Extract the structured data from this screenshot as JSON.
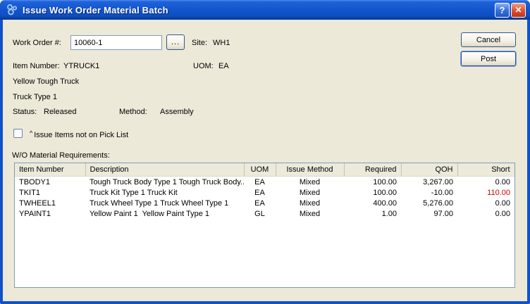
{
  "window": {
    "title": "Issue Work Order Material Batch",
    "help_label": "?",
    "close_label": "✕"
  },
  "form": {
    "work_order_label": "Work Order #:",
    "work_order_value": "10060-1",
    "lookup_label": "...",
    "site_label": "Site:",
    "site_value": "WH1",
    "item_number_label": "Item Number:",
    "item_number_value": "YTRUCK1",
    "uom_label": "UOM:",
    "uom_value": "EA",
    "item_desc_line1": "Yellow Tough Truck",
    "item_desc_line2": "Truck Type 1",
    "status_label": "Status:",
    "status_value": "Released",
    "method_label": "Method:",
    "method_value": "Assembly",
    "checkbox_caret": "^",
    "checkbox_label": "Issue Items not on Pick List",
    "checkbox_checked": false,
    "grid_caption": "W/O Material Requirements:"
  },
  "buttons": {
    "cancel": "Cancel",
    "post": "Post"
  },
  "grid": {
    "columns": [
      "Item Number",
      "Description",
      "UOM",
      "Issue Method",
      "Required",
      "QOH",
      "Short"
    ],
    "rows": [
      {
        "item": "TBODY1",
        "desc": "Tough Truck Body Type 1 Tough Truck Body...",
        "uom": "EA",
        "method": "Mixed",
        "required": "100.00",
        "qoh": "3,267.00",
        "short": "0.00",
        "short_alert": false
      },
      {
        "item": "TKIT1",
        "desc": "Truck Kit Type 1 Truck Kit",
        "uom": "EA",
        "method": "Mixed",
        "required": "100.00",
        "qoh": "-10.00",
        "short": "110.00",
        "short_alert": true
      },
      {
        "item": "TWHEEL1",
        "desc": "Truck Wheel Type 1 Truck Wheel Type 1",
        "uom": "EA",
        "method": "Mixed",
        "required": "400.00",
        "qoh": "5,276.00",
        "short": "0.00",
        "short_alert": false
      },
      {
        "item": "YPAINT1",
        "desc": "Yellow Paint 1  Yellow Paint Type 1",
        "uom": "GL",
        "method": "Mixed",
        "required": "1.00",
        "qoh": "97.00",
        "short": "0.00",
        "short_alert": false
      }
    ]
  },
  "colors": {
    "short_alert": "#cc0000",
    "titlebar_blue": "#1356cd",
    "dialog_bg": "#ece9d8",
    "field_border": "#7f9db9"
  }
}
